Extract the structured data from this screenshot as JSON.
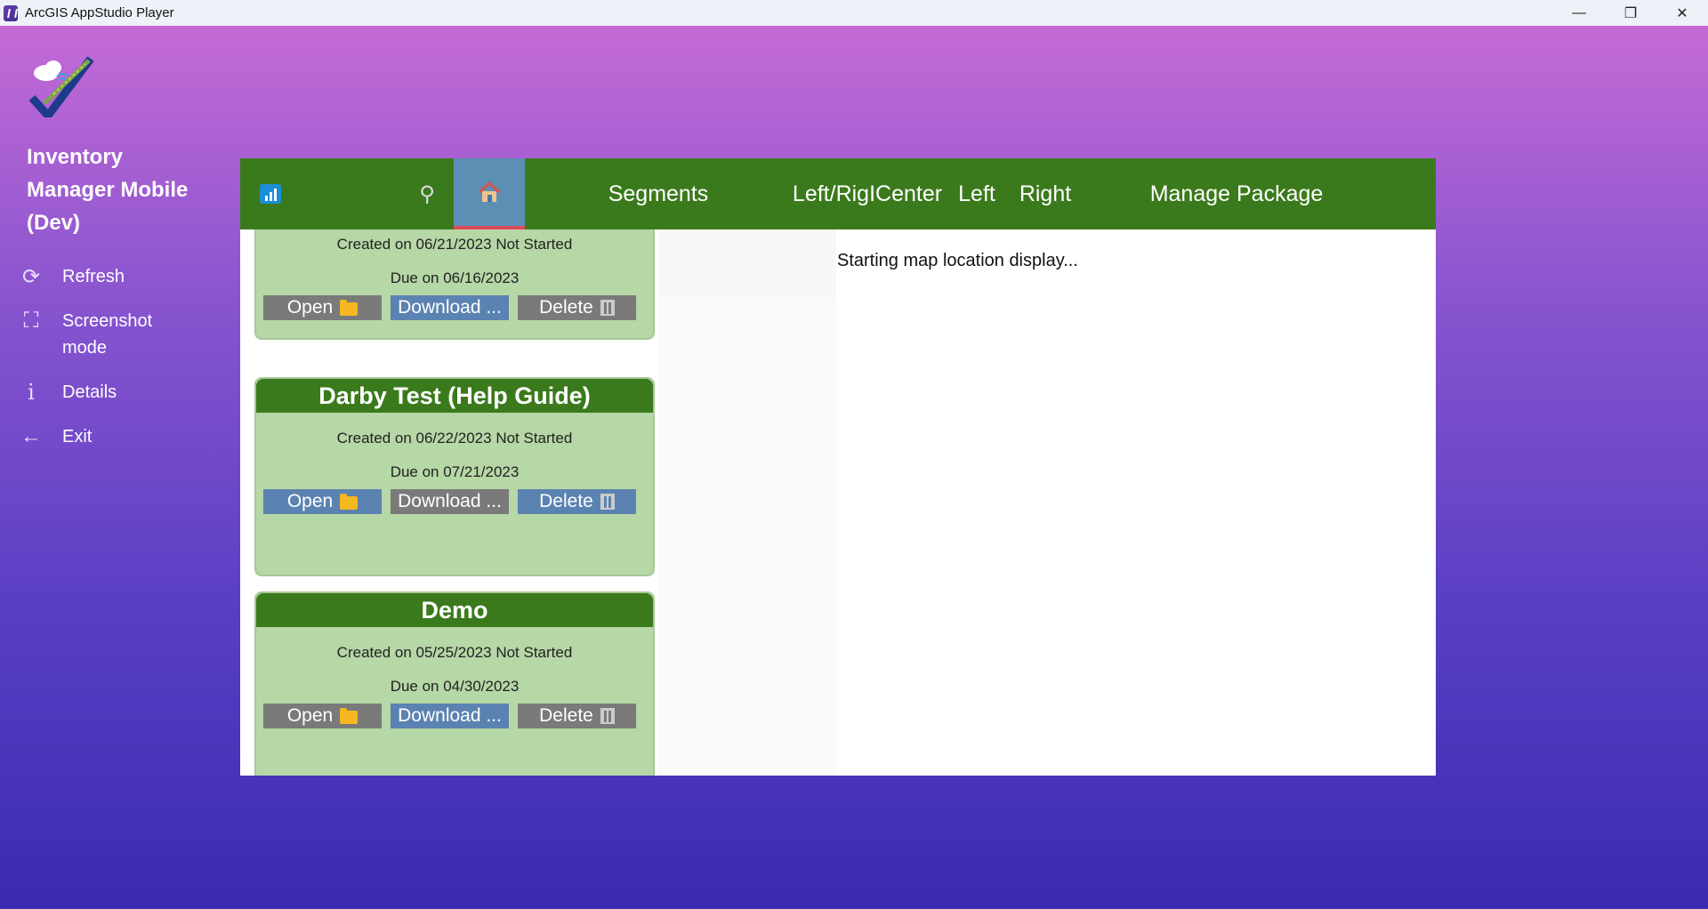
{
  "window": {
    "title": "ArcGIS AppStudio Player",
    "controls": {
      "minimize": "—",
      "maximize": "❐",
      "close": "✕"
    }
  },
  "sidebar": {
    "app_name": "Inventory Manager Mobile (Dev)",
    "items": [
      {
        "label": "Refresh",
        "icon": "refresh-icon",
        "glyph": "⟳"
      },
      {
        "label": "Screenshot mode",
        "icon": "screenshot-icon",
        "glyph": "⛶"
      },
      {
        "label": "Details",
        "icon": "info-icon",
        "glyph": "i"
      },
      {
        "label": "Exit",
        "icon": "arrow-left-icon",
        "glyph": "←"
      }
    ]
  },
  "topbar": {
    "tabs": [
      {
        "label": "Segments"
      },
      {
        "label": "Left/RigICenter"
      },
      {
        "label": "Left"
      },
      {
        "label": "Right"
      },
      {
        "label": "Manage Package"
      }
    ]
  },
  "status": "Starting map location display...",
  "cards": [
    {
      "title": "",
      "created": "Created on 06/21/2023  Not Started",
      "due": "Due on 06/16/2023",
      "buttons": {
        "open": "Open",
        "download": "Download ...",
        "delete": "Delete"
      }
    },
    {
      "title": "Darby Test (Help Guide)",
      "created": "Created on 06/22/2023  Not Started",
      "due": "Due on 07/21/2023",
      "buttons": {
        "open": "Open",
        "download": "Download ...",
        "delete": "Delete"
      }
    },
    {
      "title": "Demo",
      "created": "Created on 05/25/2023  Not Started",
      "due": "Due on 04/30/2023",
      "buttons": {
        "open": "Open",
        "download": "Download ...",
        "delete": "Delete"
      }
    }
  ]
}
